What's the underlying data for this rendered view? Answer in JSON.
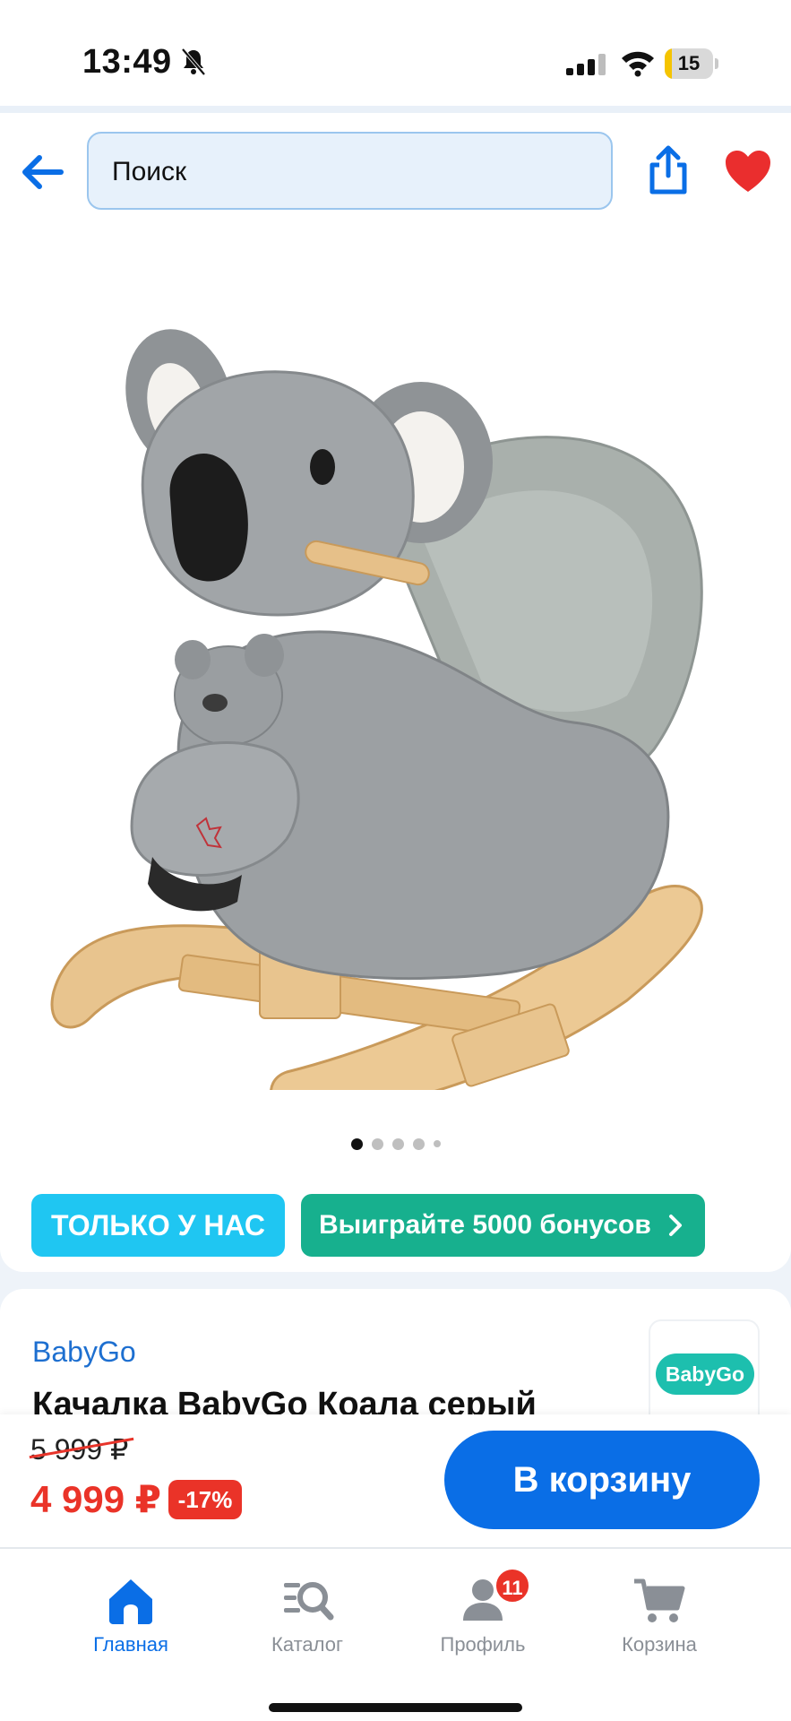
{
  "status_bar": {
    "time": "13:49",
    "battery_level": "15",
    "battery_fraction": 0.15
  },
  "header": {
    "search_placeholder": "Поиск"
  },
  "product": {
    "image_description": "koala-rocking-chair",
    "carousel": {
      "total": 5,
      "active": 0
    },
    "badges": {
      "exclusive": "ТОЛЬКО У НАС",
      "bonus": "Выиграйте 5000 бонусов"
    },
    "brand": "BabyGo",
    "brand_logo_text": "BabyGo",
    "title": "Качалка BabyGo Коала серый"
  },
  "price": {
    "old": "5 999 ₽",
    "current": "4 999 ₽",
    "discount": "-17%",
    "cart_button": "В корзину"
  },
  "nav": {
    "items": [
      {
        "label": "Главная",
        "icon": "home-icon",
        "active": true
      },
      {
        "label": "Каталог",
        "icon": "catalog-icon",
        "active": false
      },
      {
        "label": "Профиль",
        "icon": "profile-icon",
        "active": false,
        "badge": "11"
      },
      {
        "label": "Корзина",
        "icon": "cart-icon",
        "active": false
      }
    ]
  },
  "colors": {
    "accent": "#0a6ee6",
    "exclusive_badge": "#1fc6f2",
    "bonus_badge": "#17b08e",
    "price_red": "#ea3328",
    "brand_blue": "#1d6fd0"
  }
}
